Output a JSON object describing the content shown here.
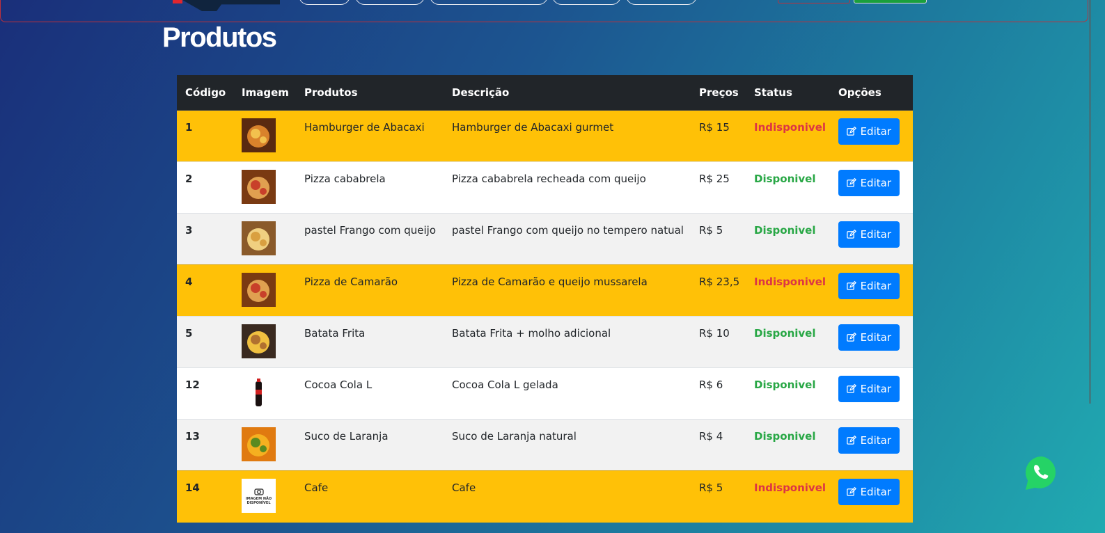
{
  "page": {
    "title": "Produtos"
  },
  "colors": {
    "header_bg": "#212529",
    "unavailable_row": "#ffc107",
    "available_text": "#28a745",
    "unavailable_text": "#dc3545",
    "edit_button": "#007bff"
  },
  "table": {
    "headers": [
      "Código",
      "Imagem",
      "Produtos",
      "Descrição",
      "Preços",
      "Status",
      "Opções"
    ],
    "rows": [
      {
        "code": "1",
        "product": "Hamburger de Abacaxi",
        "description": "Hamburger de Abacaxi gurmet",
        "price": "R$ 15",
        "status": "Indisponivel",
        "available": false,
        "image": "burger-photo",
        "action": "Editar"
      },
      {
        "code": "2",
        "product": "Pizza cababrela",
        "description": "Pizza cababrela recheada com queijo",
        "price": "R$ 25",
        "status": "Disponivel",
        "available": true,
        "image": "pizza-photo",
        "action": "Editar"
      },
      {
        "code": "3",
        "product": "pastel Frango com queijo",
        "description": "pastel Frango com queijo no tempero natual",
        "price": "R$ 5",
        "status": "Disponivel",
        "available": true,
        "image": "pastel-photo",
        "action": "Editar"
      },
      {
        "code": "4",
        "product": "Pizza de Camarão",
        "description": "Pizza de Camarão e queijo mussarela",
        "price": "R$ 23,5",
        "status": "Indisponivel",
        "available": false,
        "image": "pizza-photo",
        "action": "Editar"
      },
      {
        "code": "5",
        "product": "Batata Frita",
        "description": "Batata Frita + molho adicional",
        "price": "R$ 10",
        "status": "Disponivel",
        "available": true,
        "image": "fries-photo",
        "action": "Editar"
      },
      {
        "code": "12",
        "product": "Cocoa Cola L",
        "description": "Cocoa Cola L gelada",
        "price": "R$ 6",
        "status": "Disponivel",
        "available": true,
        "image": "soda-photo",
        "action": "Editar"
      },
      {
        "code": "13",
        "product": "Suco de Laranja",
        "description": "Suco de Laranja natural",
        "price": "R$ 4",
        "status": "Disponivel",
        "available": true,
        "image": "juice-photo",
        "action": "Editar"
      },
      {
        "code": "14",
        "product": "Cafe",
        "description": "Cafe",
        "price": "R$ 5",
        "status": "Indisponivel",
        "available": false,
        "image": "placeholder-image",
        "placeholder_text": [
          "IMAGEM NÃO",
          "DISPONÍVEL"
        ],
        "action": "Editar"
      }
    ]
  },
  "floating": {
    "icon": "whatsapp-icon"
  }
}
